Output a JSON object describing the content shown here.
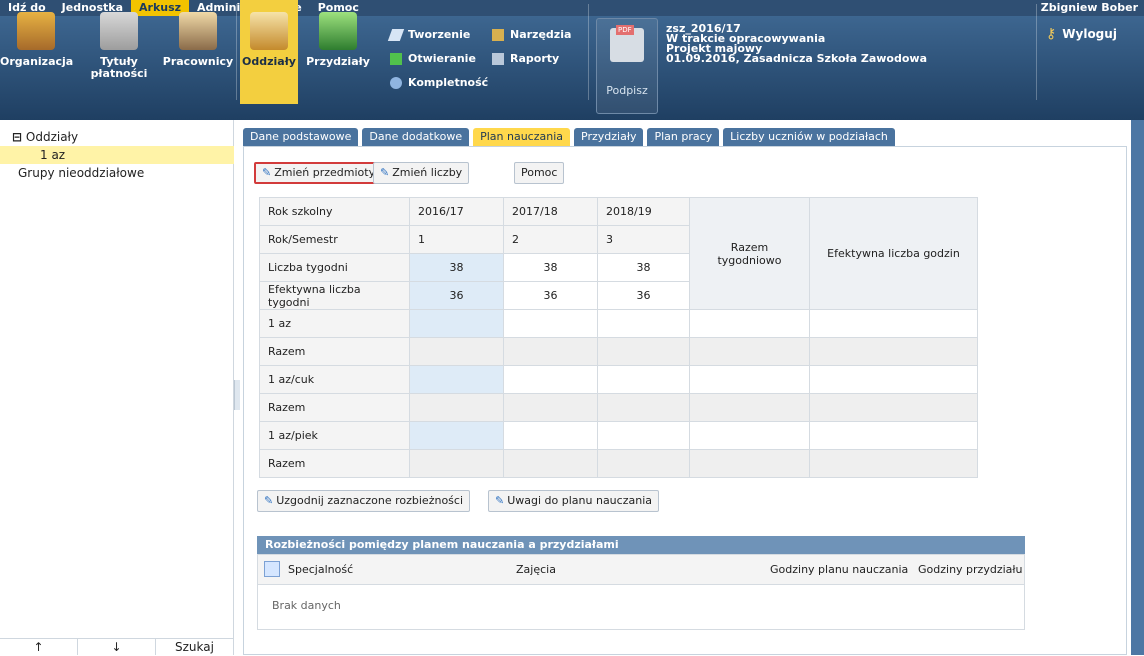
{
  "top_menu": [
    {
      "label": "Idź do"
    },
    {
      "label": "Jednostka"
    },
    {
      "label": "Arkusz",
      "active": true
    },
    {
      "label": "Administrowanie"
    },
    {
      "label": "Pomoc"
    }
  ],
  "user": {
    "name": "Zbigniew Bober"
  },
  "ribbon": {
    "buttons": [
      {
        "label": "Organizacja"
      },
      {
        "label": "Tytuły\npłatności"
      },
      {
        "label": "Pracownicy"
      },
      {
        "label": "Oddziały",
        "active": true
      },
      {
        "label": "Przydziały"
      }
    ],
    "small": [
      {
        "label": "Tworzenie"
      },
      {
        "label": "Otwieranie"
      },
      {
        "label": "Kompletność"
      },
      {
        "label": "Narzędzia"
      },
      {
        "label": "Raporty"
      }
    ],
    "pdf_label": "Podpisz",
    "pdf_badge": "PDF",
    "info": [
      "zsz_2016/17",
      "W trakcie opracowywania",
      "Projekt majowy",
      "01.09.2016, Zasadnicza Szkoła Zawodowa"
    ],
    "logout": "Wyloguj"
  },
  "sidebar": {
    "tree": [
      {
        "label": "Oddziały",
        "level": 0
      },
      {
        "label": "1 az",
        "level": 1,
        "selected": true
      },
      {
        "label": "Grupy nieoddziałowe",
        "level": 0
      }
    ],
    "footer": [
      "↑",
      "↓",
      "Szukaj"
    ]
  },
  "tabs": [
    {
      "label": "Dane podstawowe"
    },
    {
      "label": "Dane dodatkowe"
    },
    {
      "label": "Plan nauczania",
      "active": true
    },
    {
      "label": "Przydziały"
    },
    {
      "label": "Plan pracy"
    },
    {
      "label": "Liczby uczniów w podziałach"
    }
  ],
  "toolbar": {
    "change_subjects": "Zmień przedmioty",
    "change_numbers": "Zmień liczby",
    "help": "Pomoc",
    "reconcile": "Uzgodnij zaznaczone rozbieżności",
    "notes": "Uwagi do planu nauczania"
  },
  "plan_table": {
    "header_rows": [
      {
        "label": "Rok szkolny",
        "values": [
          "2016/17",
          "2017/18",
          "2018/19"
        ]
      },
      {
        "label": "Rok/Semestr",
        "values": [
          "1",
          "2",
          "3"
        ]
      },
      {
        "label": "Liczba tygodni",
        "values": [
          "38",
          "38",
          "38"
        ]
      },
      {
        "label": "Efektywna liczba tygodni",
        "values": [
          "36",
          "36",
          "36"
        ]
      }
    ],
    "right_headers": [
      "Razem tygodniowo",
      "Efektywna liczba godzin"
    ],
    "data_rows": [
      {
        "label": "1 az"
      },
      {
        "label": "Razem"
      },
      {
        "label": "1 az/cuk"
      },
      {
        "label": "Razem"
      },
      {
        "label": "1 az/piek"
      },
      {
        "label": "Razem"
      }
    ]
  },
  "discrepancies": {
    "title": "Rozbieżności pomiędzy planem nauczania a przydziałami",
    "columns": [
      "Specjalność",
      "Zajęcia",
      "Godziny planu nauczania",
      "Godziny przydziału"
    ],
    "empty": "Brak danych"
  },
  "colors": {
    "accent": "#ffd84c",
    "header": "#2f4f73",
    "ribbon_top": "#3d6690"
  },
  "icons": [
    "pencil-icon",
    "pdf-icon",
    "key-icon",
    "tools-icon",
    "reports-icon",
    "check-icon"
  ]
}
